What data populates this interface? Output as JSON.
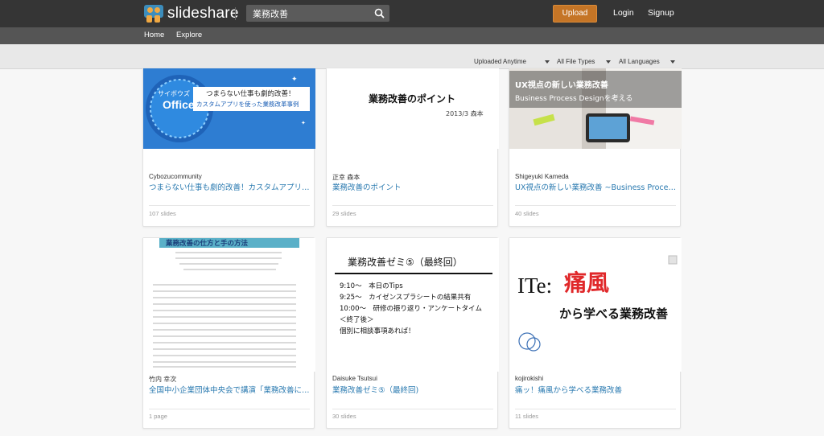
{
  "header": {
    "logo_text": "slideshare",
    "search_value": "業務改善",
    "upload_label": "Upload",
    "login_label": "Login",
    "signup_label": "Signup"
  },
  "nav": {
    "home": "Home",
    "explore": "Explore"
  },
  "filters": {
    "time": "Uploaded Anytime",
    "file_types": "All File Types",
    "languages": "All Languages"
  },
  "cards": [
    {
      "author": "Cybozucommunity",
      "title": "つまらない仕事も劇的改善！カスタムアプリ…",
      "slides": "107 slides",
      "thumb": {
        "badge_top": "サイボウズ",
        "badge_main": "Office",
        "line1": "つまらない仕事も劇的改善！",
        "line2": "カスタムアプリを使った業務改革事例"
      }
    },
    {
      "author": "正幸 森本",
      "title": "業務改善のポイント",
      "slides": "29 slides",
      "thumb": {
        "heading": "業務改善のポイント",
        "sub": "2013/3 森本"
      }
    },
    {
      "author": "Shigeyuki Kameda",
      "title": "UX視点の新しい業務改善 ~Business Proces…",
      "slides": "40 slides",
      "thumb": {
        "line1": "UX視点の新しい業務改善",
        "line2": "Business Process Designを考える"
      }
    },
    {
      "author": "竹内 幸次",
      "title": "全国中小企業団体中央会で講演「業務改善に…",
      "slides": "1 page",
      "thumb": {
        "heading": "業務改善の仕方と手の方法"
      }
    },
    {
      "author": "Daisuke Tsutsui",
      "title": "業務改善ゼミ⑤（最終回)",
      "slides": "30 slides",
      "thumb": {
        "heading": "業務改善ゼミ⑤（最終回）",
        "lines": [
          "9:10〜　本日のTips",
          "9:25〜　カイゼンスプラシートの結果共有",
          "10:00〜　研修の振り返り・アンケートタイム",
          "＜終了後＞",
          "個別に相談事項あれば！"
        ]
      }
    },
    {
      "author": "kojirokishi",
      "title": "痛ッ！痛風から学べる業務改善",
      "slides": "11 slides",
      "thumb": {
        "it": "ITe:",
        "red": "痛風",
        "black": "から学べる業務改善"
      }
    }
  ]
}
